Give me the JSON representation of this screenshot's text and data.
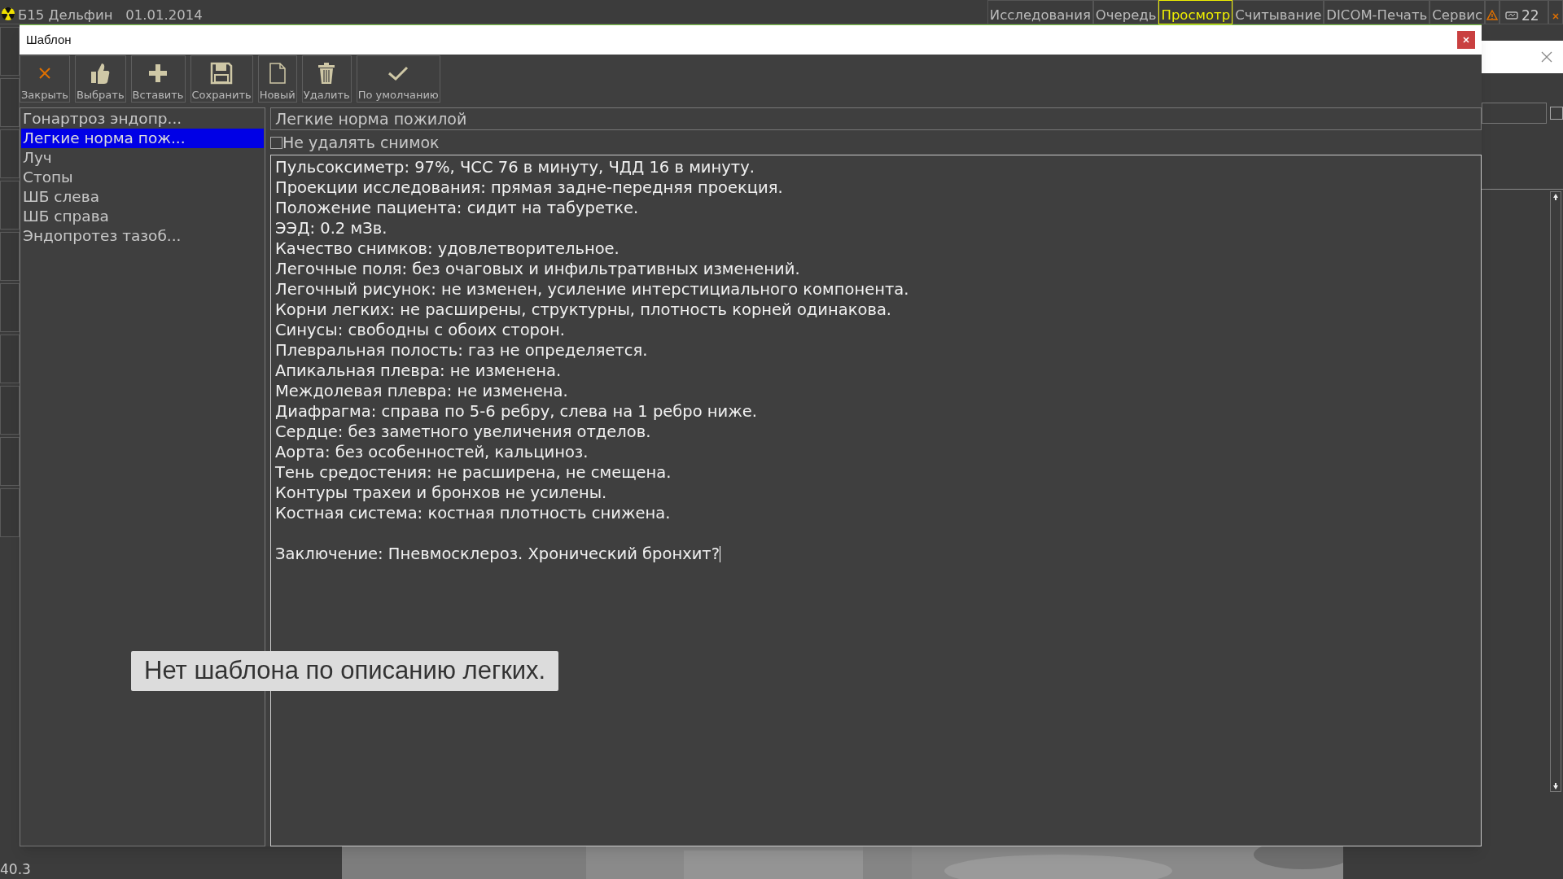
{
  "app": {
    "title": "Б15 Дельфин   01.01.2014",
    "tabs": [
      {
        "label": "Исследования",
        "selected": false
      },
      {
        "label": "Очередь",
        "selected": false
      },
      {
        "label": "Просмотр",
        "selected": true
      },
      {
        "label": "Считывание",
        "selected": false
      },
      {
        "label": "DICOM-Печать",
        "selected": false
      },
      {
        "label": "Сервис",
        "selected": false
      }
    ],
    "device_count": "22",
    "status": "40.3",
    "side_checkbox": {
      "checked": false
    }
  },
  "dialog": {
    "title": "Шаблон",
    "toolbar": [
      {
        "label": "Закрыть",
        "kind": "close"
      },
      {
        "label": "Выбрать",
        "kind": "choose"
      },
      {
        "label": "Вставить",
        "kind": "insert"
      },
      {
        "label": "Сохранить",
        "kind": "save"
      },
      {
        "label": "Новый",
        "kind": "new"
      },
      {
        "label": "Удалить",
        "kind": "delete"
      },
      {
        "label": "По умолчанию",
        "kind": "default"
      }
    ],
    "templates": [
      {
        "label": "Гонартроз эндопр...",
        "selected": false
      },
      {
        "label": "Легкие норма пож...",
        "selected": true
      },
      {
        "label": "Луч",
        "selected": false
      },
      {
        "label": "Стопы",
        "selected": false
      },
      {
        "label": "ШБ слева",
        "selected": false
      },
      {
        "label": "ШБ справа",
        "selected": false
      },
      {
        "label": "Эндопротез тазоб...",
        "selected": false
      }
    ],
    "template_name": "Легкие норма пожилой",
    "keep_image": {
      "label": "Не удалять снимок",
      "checked": false
    },
    "text": [
      "Пульсоксиметр: 97%, ЧСС 76 в минуту, ЧДД 16 в минуту.",
      "Проекции исследования: прямая задне-передняя проекция.",
      "Положение пациента: сидит на табуретке.",
      "ЭЭД: 0.2 мЗв.",
      "Качество снимков: удовлетворительное.",
      "Легочные поля: без очаговых и инфильтративных изменений.",
      "Легочный рисунок: не изменен, усиление интерстициального компонента.",
      "Корни легких: не расширены, структурны, плотность корней одинакова.",
      "Синусы: свободны с обоих сторон.",
      "Плевральная полость: газ не определяется.",
      "Апикальная плевра: не изменена.",
      "Междолевая плевра: не изменена.",
      "Диафрагма: справа по 5-6 ребру, слева на 1 ребро ниже.",
      "Сердце: без заметного увеличения отделов.",
      "Аорта: без особенностей, кальциноз.",
      "Тень средостения: не расширена, не смещена.",
      "Контуры трахеи и бронхов не усилены.",
      "Костная система: костная плотность снижена."
    ],
    "conclusion": "Заключение: Пневмосклероз. Хронический бронхит?"
  },
  "tooltip": "Нет шаблона по описанию легких."
}
